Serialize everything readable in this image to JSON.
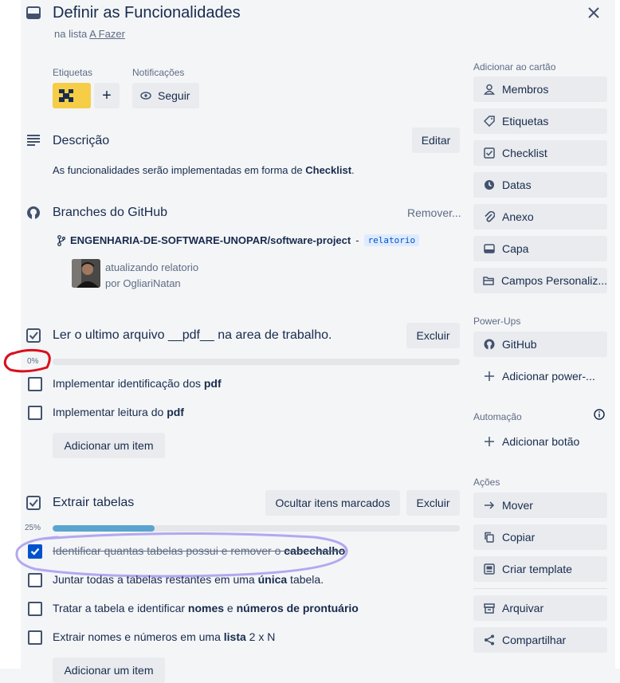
{
  "card": {
    "title": "Definir as Funcionalidades",
    "list_prefix": "na lista",
    "list_name": "A Fazer"
  },
  "labels_section": {
    "label": "Etiquetas",
    "add": "+"
  },
  "notifications": {
    "label": "Notificações",
    "follow": "Seguir"
  },
  "description": {
    "heading": "Descrição",
    "edit": "Editar",
    "text_before": "As funcionalidades serão implementadas em forma de ",
    "text_bold": "Checklist",
    "text_after": "."
  },
  "github": {
    "heading": "Branches do GitHub",
    "remove": "Remover...",
    "repo": "ENGENHARIA-DE-SOFTWARE-UNOPAR/software-project",
    "separator": "-",
    "branch": "relatorio",
    "commit_message": "atualizando relatorio",
    "commit_author": "por OgliariNatan"
  },
  "checklists": [
    {
      "title": "Ler o ultimo arquivo __pdf__ na area de trabalho.",
      "delete": "Excluir",
      "progress_label": "0%",
      "progress": 0,
      "items": [
        {
          "pre": "Implementar identificação dos ",
          "bold": "pdf",
          "post": "",
          "checked": false
        },
        {
          "pre": "Implementar leitura do ",
          "bold": "pdf",
          "post": "",
          "checked": false
        }
      ],
      "add_item": "Adicionar um item"
    },
    {
      "title": "Extrair tabelas",
      "hide_checked": "Ocultar itens marcados",
      "delete": "Excluir",
      "progress_label": "25%",
      "progress": 0.25,
      "items": [
        {
          "pre": "Identificar quantas tabelas possui e remover o ",
          "bold": "cabechalho",
          "post": "",
          "checked": true
        },
        {
          "pre": "Juntar todas a tabelas restantes em uma ",
          "bold": "única",
          "post": " tabela.",
          "checked": false
        },
        {
          "pre": "Tratar a tabela e identificar ",
          "bold": "nomes",
          "mid": " e ",
          "bold2": "números de prontuário",
          "post": "",
          "checked": false
        },
        {
          "pre": "Extrair nomes e números em uma ",
          "bold": "lista",
          "post": " 2 x N",
          "checked": false
        }
      ],
      "add_item": "Adicionar um item"
    }
  ],
  "sidebar": {
    "add_to_card": "Adicionar ao cartão",
    "add_items": [
      {
        "label": "Membros",
        "icon": "person-icon"
      },
      {
        "label": "Etiquetas",
        "icon": "tag-icon"
      },
      {
        "label": "Checklist",
        "icon": "checklist-icon"
      },
      {
        "label": "Datas",
        "icon": "clock-icon"
      },
      {
        "label": "Anexo",
        "icon": "paperclip-icon"
      },
      {
        "label": "Capa",
        "icon": "cover-icon"
      },
      {
        "label": "Campos Personaliz...",
        "icon": "custom-fields-icon"
      }
    ],
    "powerups_title": "Power-Ups",
    "github": "GitHub",
    "add_powerup": "Adicionar power-...",
    "automation_title": "Automação",
    "add_button": "Adicionar botão",
    "actions_title": "Ações",
    "actions": [
      {
        "label": "Mover",
        "icon": "arrow-right-icon"
      },
      {
        "label": "Copiar",
        "icon": "copy-icon"
      },
      {
        "label": "Criar template",
        "icon": "template-icon"
      },
      {
        "label": "Arquivar",
        "icon": "archive-icon"
      },
      {
        "label": "Compartilhar",
        "icon": "share-icon"
      }
    ]
  },
  "colors": {
    "label_yellow": "#f5cd47",
    "accent": "#0052cc",
    "progress": "#5ba4cf",
    "annotation_red": "#d9101f",
    "annotation_purple": "#b3a8f0"
  }
}
